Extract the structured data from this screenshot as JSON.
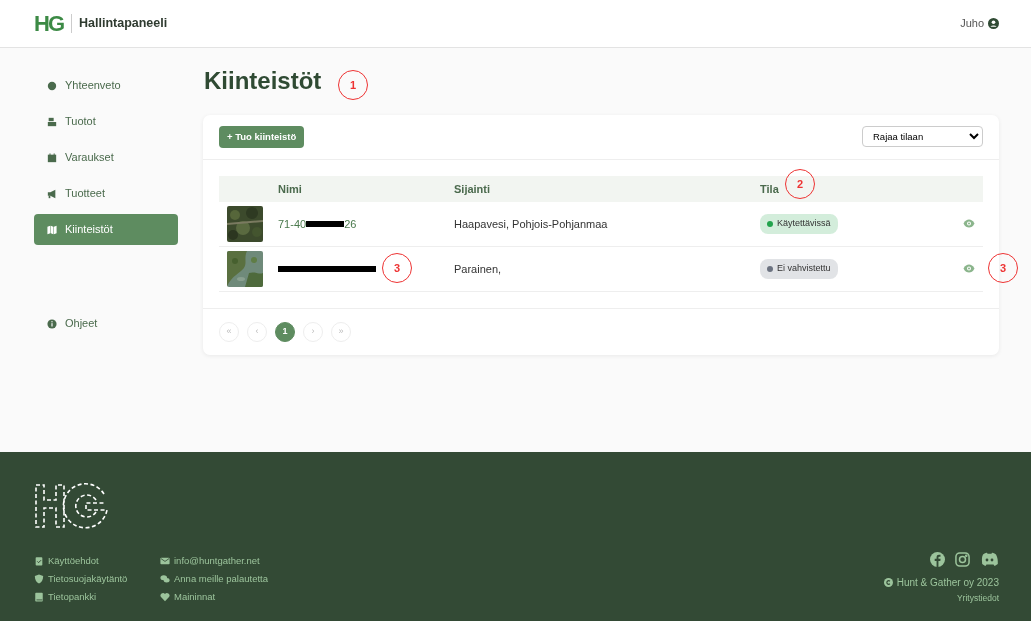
{
  "navbar": {
    "brand_logo": "HG",
    "brand": "Hallintapaneeli",
    "user": "Juho"
  },
  "sidebar": {
    "items": [
      {
        "label": "Yhteenveto",
        "selected": false
      },
      {
        "label": "Tuotot",
        "selected": false
      },
      {
        "label": "Varaukset",
        "selected": false
      },
      {
        "label": "Tuotteet",
        "selected": false
      },
      {
        "label": "Kiinteistöt",
        "selected": true
      }
    ],
    "help": {
      "label": "Ohjeet"
    }
  },
  "page_title": "Kiinteistöt",
  "toolbar": {
    "add_button": "+ Tuo kiinteistö",
    "filter": "Rajaa tilaan"
  },
  "table": {
    "columns": [
      "Nimi",
      "Sijainti",
      "Tila"
    ],
    "rows": [
      {
        "name_start": "71-40",
        "name_end": "26",
        "location": "Haapavesi, Pohjois-Pohjanmaa",
        "status": {
          "label": "Käytettävissä",
          "color": "#22a34c"
        }
      },
      {
        "location": "Parainen,",
        "status": {
          "label": "Ei vahvistettu",
          "color": "#6b7280"
        }
      }
    ]
  },
  "pagination": {
    "pages": [
      {
        "label": "«",
        "kind": "nav"
      },
      {
        "label": "‹",
        "kind": "nav"
      },
      {
        "label": "1",
        "kind": "page",
        "selected": true
      },
      {
        "label": "›",
        "kind": "nav"
      },
      {
        "label": "»",
        "kind": "nav"
      }
    ]
  },
  "annotations": [
    {
      "label": "1"
    },
    {
      "label": "2"
    },
    {
      "label": "3"
    },
    {
      "label": "3"
    }
  ],
  "footer": {
    "links_left": [
      {
        "label": "Käyttöehdot"
      },
      {
        "label": "Tietosuojakäytäntö"
      },
      {
        "label": "Tietopankki"
      }
    ],
    "links_right": [
      {
        "label": "info@huntgather.net"
      },
      {
        "label": "Anna meille palautetta"
      },
      {
        "label": "Maininnat"
      }
    ],
    "copyright": "Hunt & Gather oy 2023",
    "company_info": "Yritystiedot"
  }
}
